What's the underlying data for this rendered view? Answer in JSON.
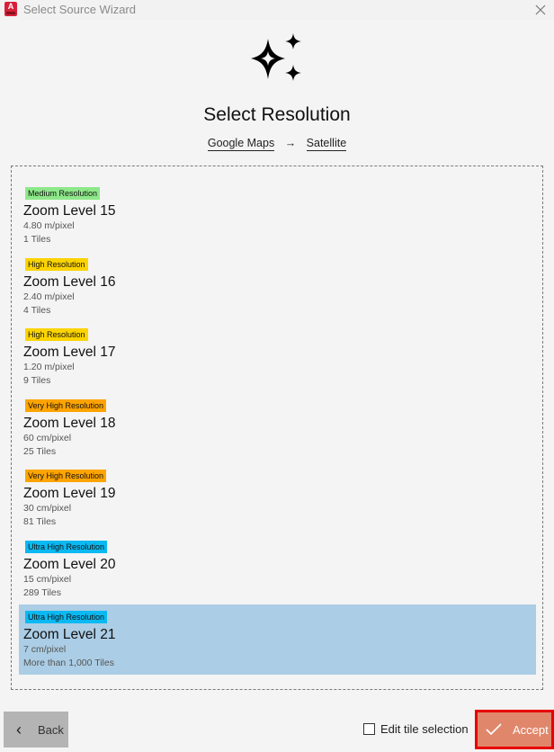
{
  "window": {
    "title": "Select Source Wizard",
    "app_icon": "autocad-icon",
    "close_icon": "close-icon"
  },
  "header": {
    "icon": "sparkles-icon",
    "title": "Select Resolution",
    "breadcrumb": {
      "source": "Google Maps",
      "separator": "→",
      "type": "Satellite"
    }
  },
  "resolutions": [
    {
      "badge": "Medium Resolution",
      "badge_color": "#8ee88a",
      "title": "Zoom Level 15",
      "pixel_size": "4.80 m/pixel",
      "tiles": "1 Tiles",
      "selected": false
    },
    {
      "badge": "High Resolution",
      "badge_color": "#fcd401",
      "title": "Zoom Level 16",
      "pixel_size": "2.40 m/pixel",
      "tiles": "4 Tiles",
      "selected": false
    },
    {
      "badge": "High Resolution",
      "badge_color": "#fcd401",
      "title": "Zoom Level 17",
      "pixel_size": "1.20 m/pixel",
      "tiles": "9 Tiles",
      "selected": false
    },
    {
      "badge": "Very High Resolution",
      "badge_color": "#fda401",
      "title": "Zoom Level 18",
      "pixel_size": "60 cm/pixel",
      "tiles": "25 Tiles",
      "selected": false
    },
    {
      "badge": "Very High Resolution",
      "badge_color": "#fda401",
      "title": "Zoom Level 19",
      "pixel_size": "30 cm/pixel",
      "tiles": "81 Tiles",
      "selected": false
    },
    {
      "badge": "Ultra High Resolution",
      "badge_color": "#0ab9f2",
      "title": "Zoom Level 20",
      "pixel_size": "15 cm/pixel",
      "tiles": "289 Tiles",
      "selected": false
    },
    {
      "badge": "Ultra High Resolution",
      "badge_color": "#0ab9f2",
      "title": "Zoom Level 21",
      "pixel_size": "7 cm/pixel",
      "tiles": "More than 1,000 Tiles",
      "selected": true
    }
  ],
  "footer": {
    "back_label": "Back",
    "edit_tile_label": "Edit tile selection",
    "edit_tile_checked": false,
    "accept_label": "Accept"
  },
  "colors": {
    "selected_bg": "#abcde5",
    "accept_bg": "#e0876b",
    "accept_border": "#e80000"
  }
}
